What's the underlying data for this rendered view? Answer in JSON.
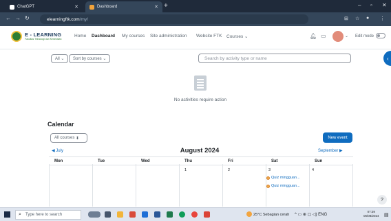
{
  "browser": {
    "tabs": [
      {
        "title": "ChatGPT",
        "active": false
      },
      {
        "title": "Dashboard",
        "active": true
      }
    ],
    "new_tab_glyph": "+",
    "url_host": "elearningftk.com",
    "url_path": "/my/"
  },
  "header": {
    "brand": "E - LEARNING",
    "brand_sub": "Fakultas Teknologi dan Kesehatan",
    "nav": [
      "Home",
      "Dashboard",
      "My courses",
      "Site administration",
      "Website FTK",
      "Courses"
    ],
    "active_nav": "Dashboard",
    "edit_mode_label": "Edit mode"
  },
  "timeline": {
    "filter_all": "All",
    "sort_label": "Sort by courses",
    "search_placeholder": "Search by activity type or name",
    "empty_message": "No activities require action"
  },
  "calendar": {
    "title": "Calendar",
    "course_filter": "All courses",
    "new_event_label": "New event",
    "prev_month": "July",
    "month": "August 2024",
    "next_month": "September",
    "weekdays": [
      "Mon",
      "Tue",
      "Wed",
      "Thu",
      "Fri",
      "Sat",
      "Sun"
    ],
    "first_week_days": [
      "",
      "",
      "",
      "1",
      "2",
      "3",
      "4"
    ],
    "events": [
      "Quiz mingguan...",
      "Quiz mingguan..."
    ]
  },
  "taskbar": {
    "search_placeholder": "Type here to search",
    "weather": "25°C  Sebagian cerah",
    "language": "ENG",
    "time": "07:39",
    "date": "06/08/2024"
  },
  "colors": {
    "primary": "#0f6cbf",
    "chrome_dark": "#1f2a3a",
    "chrome_mid": "#34465a",
    "event_dot": "#f0ad4e"
  }
}
